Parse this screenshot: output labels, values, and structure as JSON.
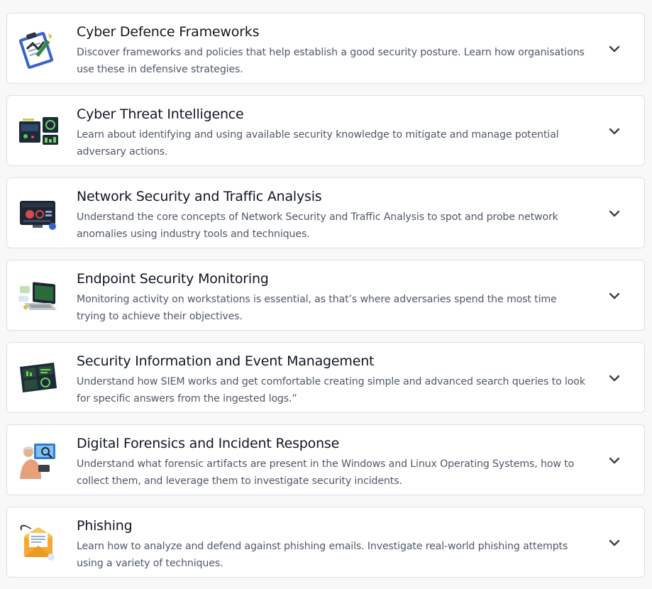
{
  "modules": [
    {
      "title": "Cyber Defence Frameworks",
      "description": "Discover frameworks and policies that help establish a good security posture. Learn how organisations use these in defensive strategies.",
      "icon": "clipboard-policy-icon"
    },
    {
      "title": "Cyber Threat Intelligence",
      "description": "Learn about identifying and using available security knowledge to mitigate and manage potential adversary actions.",
      "icon": "threat-intel-dashboard-icon"
    },
    {
      "title": "Network Security and Traffic Analysis",
      "description": "Understand the core concepts of Network Security and Traffic Analysis to spot and probe network anomalies using industry tools and techniques.",
      "icon": "network-monitor-icon"
    },
    {
      "title": "Endpoint Security Monitoring",
      "description": "Monitoring activity on workstations is essential, as that’s where adversaries spend the most time trying to achieve their objectives.",
      "icon": "laptop-monitoring-icon"
    },
    {
      "title": "Security Information and Event Management",
      "description": "Understand how SIEM works and get comfortable creating simple and advanced search queries to look for specific answers from the ingested logs.”",
      "icon": "siem-dashboard-icon"
    },
    {
      "title": "Digital Forensics and Incident Response",
      "description": "Understand what forensic artifacts are present in the Windows and Linux Operating Systems, how to collect them, and leverage them to investigate security incidents.",
      "icon": "forensic-analyst-icon"
    },
    {
      "title": "Phishing",
      "description": "Learn how to analyze and defend against phishing emails. Investigate real-world phishing attempts using a variety of techniques.",
      "icon": "phishing-email-icon"
    }
  ],
  "expand_icon": "chevron-down-icon",
  "colors": {
    "page_background": "#f8f8f8",
    "card_background": "#ffffff",
    "card_border": "#dcdfe4",
    "title_text": "#111722",
    "description_text": "#505968"
  }
}
